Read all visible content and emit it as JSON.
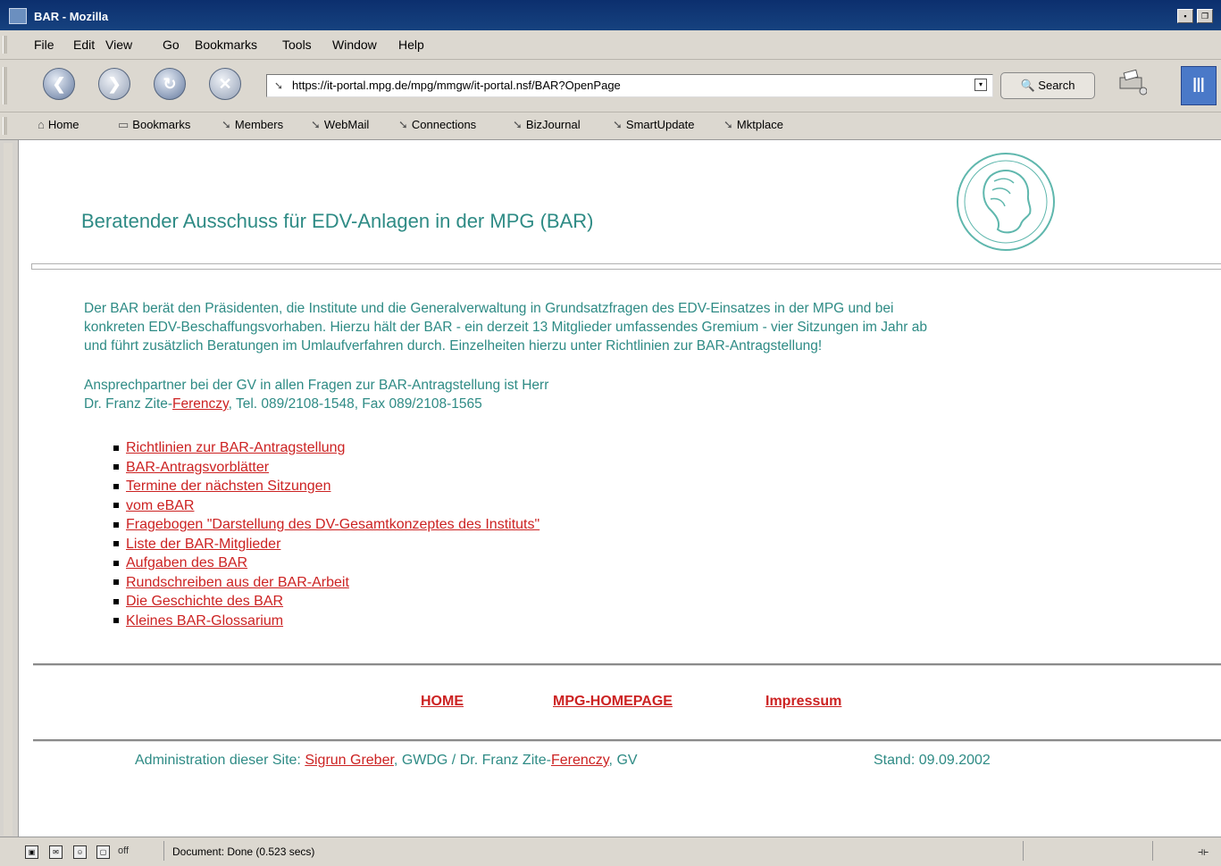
{
  "window": {
    "title": "BAR - Mozilla"
  },
  "menu": [
    "File",
    "Edit",
    "View",
    "Go",
    "Bookmarks",
    "Tools",
    "Window",
    "Help"
  ],
  "nav": {
    "url": "https://it-portal.mpg.de/mpg/mmgw/it-portal.nsf/BAR?OpenPage",
    "search_label": "Search"
  },
  "personal_toolbar": [
    "Home",
    "Bookmarks",
    "Members",
    "WebMail",
    "Connections",
    "BizJournal",
    "SmartUpdate",
    "Mktplace"
  ],
  "page": {
    "heading": "Beratender Ausschuss für EDV-Anlagen in der MPG (BAR)",
    "intro_lines": [
      "Der BAR berät den Präsidenten, die Institute und die Generalverwaltung in Grundsatzfragen des EDV-Einsatzes in der MPG und bei",
      "konkreten EDV-Beschaffungsvorhaben. Hierzu hält der BAR - ein derzeit 13 Mitglieder umfassendes Gremium - vier Sitzungen im Jahr ab",
      "und führt zusätzlich Beratungen im Umlaufverfahren durch. Einzelheiten hierzu unter Richtlinien zur BAR-Antragstellung!"
    ],
    "contact_line1": "Ansprechpartner bei der GV in allen Fragen zur BAR-Antragstellung ist Herr",
    "contact_prefix": "Dr. Franz Zite-",
    "contact_link": "Ferenczy",
    "contact_suffix": ", Tel. 089/2108-1548, Fax 089/2108-1565",
    "links": [
      "Richtlinien zur BAR-Antragstellung",
      "BAR-Antragsvorblätter",
      "Termine der nächsten Sitzungen",
      "vom eBAR",
      "Fragebogen \"Darstellung des DV-Gesamtkonzeptes des Instituts\"",
      "Liste der BAR-Mitglieder",
      "Aufgaben des BAR",
      "Rundschreiben aus der BAR-Arbeit",
      "Die Geschichte des BAR",
      "Kleines BAR-Glossarium"
    ],
    "footer_links": [
      "HOME",
      "MPG-HOMEPAGE",
      "Impressum"
    ],
    "admin_prefix": "Administration dieser Site: ",
    "admin_link1": "Sigrun Greber",
    "admin_middle": ", GWDG / Dr. Franz Zite-",
    "admin_link2": "Ferenczy",
    "admin_suffix": ", GV",
    "stand": "Stand: 09.09.2002"
  },
  "status": {
    "text": "Document: Done (0.523 secs)",
    "mode": "off"
  }
}
